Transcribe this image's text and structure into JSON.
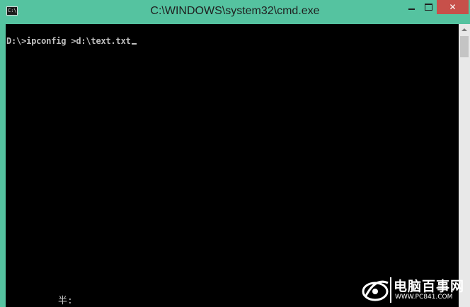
{
  "window": {
    "title": "C:\\WINDOWS\\system32\\cmd.exe",
    "icon_label": "C:\\_",
    "minimize_glyph": "minimize-icon",
    "maximize_glyph": "maximize-icon",
    "close_label": "✕"
  },
  "console": {
    "prompt_line": "D:\\>ipconfig >d:\\text.txt",
    "ime_status": "半:"
  },
  "watermark": {
    "brand": "电脑百事网",
    "site": "WWW.PC841.COM"
  },
  "colors": {
    "titlebar": "#55c3a0",
    "close_button": "#c7504a",
    "console_bg": "#000000",
    "console_text": "#c0c0c0"
  }
}
